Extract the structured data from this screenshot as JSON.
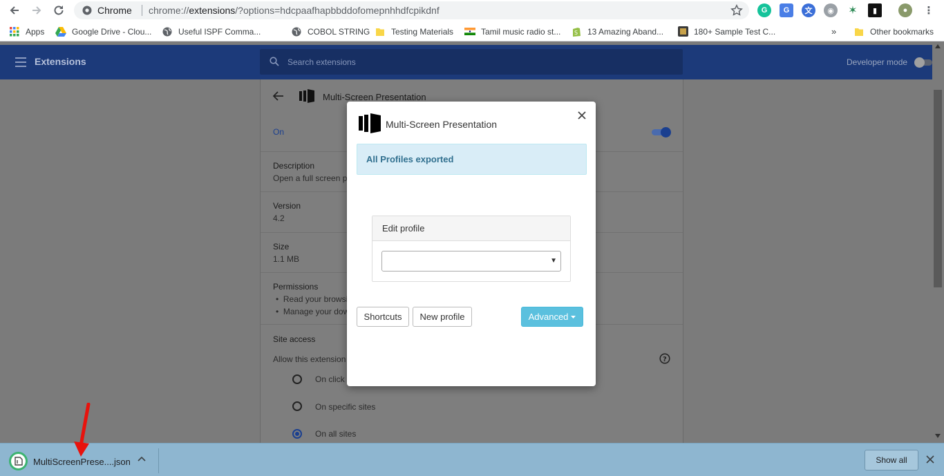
{
  "browser": {
    "omnibox": {
      "site_label": "Chrome",
      "url_scheme": "chrome://",
      "url_host": "extensions",
      "url_path": "/?options=hdcpaafhapbbddofomepnhhdfcpikdnf"
    }
  },
  "bookmarks": [
    {
      "label": "Apps",
      "icon": "apps-grid-icon"
    },
    {
      "label": "Google Drive - Clou...",
      "icon": "google-drive-icon"
    },
    {
      "label": "Useful ISPF Comma...",
      "icon": "globe-icon"
    },
    {
      "label": "COBOL STRING",
      "icon": "globe-icon"
    },
    {
      "label": "Testing Materials",
      "icon": "folder-icon"
    },
    {
      "label": "Tamil music radio st...",
      "icon": "india-flag-icon"
    },
    {
      "label": "13 Amazing Aband...",
      "icon": "shopify-icon"
    },
    {
      "label": "180+ Sample Test C...",
      "icon": "site-favicon-icon"
    }
  ],
  "bookmarks_overflow": "»",
  "other_bookmarks": "Other bookmarks",
  "extensions_page": {
    "title": "Extensions",
    "search_placeholder": "Search extensions",
    "developer_mode": "Developer mode",
    "detail": {
      "name": "Multi-Screen Presentation",
      "status": "On",
      "description_label": "Description",
      "description_text": "Open a full screen pr",
      "version_label": "Version",
      "version_value": "4.2",
      "size_label": "Size",
      "size_value": "1.1 MB",
      "permissions_label": "Permissions",
      "permissions": [
        "Read your browsi",
        "Manage your dow"
      ],
      "site_access_label": "Site access",
      "site_access_question": "Allow this extension",
      "site_access_options": [
        {
          "label": "On click",
          "checked": false
        },
        {
          "label": "On specific sites",
          "checked": false
        },
        {
          "label": "On all sites",
          "checked": true
        }
      ]
    }
  },
  "modal": {
    "title": "Multi-Screen Presentation",
    "alert": "All Profiles exported",
    "panel_title": "Edit profile",
    "select_value": "",
    "buttons": {
      "shortcuts": "Shortcuts",
      "new_profile": "New profile",
      "advanced": "Advanced"
    }
  },
  "download_bar": {
    "file_name": "MultiScreenPrese....json",
    "show_all": "Show all"
  },
  "colors": {
    "header_bg": "#1c3a7a",
    "alert_bg": "#d9edf7",
    "alert_text": "#31708f",
    "advanced_bg": "#5bc0de",
    "download_bar_bg": "#8eb6d0",
    "annotation_arrow": "#e8120c"
  }
}
